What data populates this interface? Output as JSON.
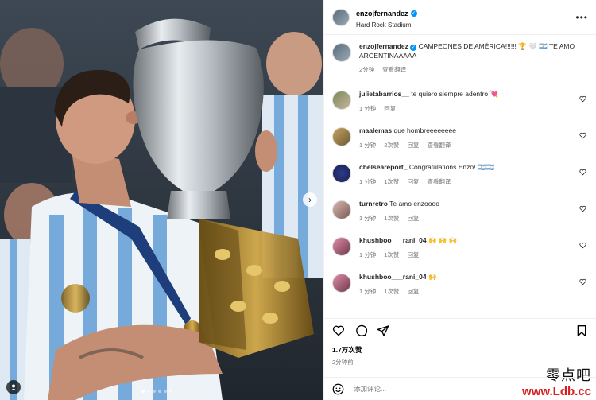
{
  "post": {
    "username": "enzojfernandez",
    "location": "Hard Rock Stadium",
    "more_icon": "more-horizontal-icon"
  },
  "caption": {
    "username": "enzojfernandez",
    "text": "CAMPEONES DE AMÉRICA!!!!!! 🏆 🤍 🇦🇷 TE AMO ARGENTINAAAAA",
    "time": "2分钟",
    "translate": "查看翻译"
  },
  "comments": [
    {
      "username": "julietabarrios__",
      "text": "te quiero siempre adentro 💘",
      "time": "1 分钟",
      "likes": "",
      "reply": "回复",
      "translate": ""
    },
    {
      "username": "maalemas",
      "text": "que hombreeeeeeee",
      "time": "1 分钟",
      "likes": "2次赞",
      "reply": "回复",
      "translate": "查看翻译"
    },
    {
      "username": "chelseareport_",
      "text": "Congratulations Enzo! 🇦🇷🇦🇷",
      "time": "1 分钟",
      "likes": "1次赞",
      "reply": "回复",
      "translate": "查看翻译"
    },
    {
      "username": "turnretro",
      "text": "Te amo enzoooo",
      "time": "1 分钟",
      "likes": "1次赞",
      "reply": "回复",
      "translate": ""
    },
    {
      "username": "khushboo___rani_04",
      "text": "🙌 🙌 🙌",
      "time": "1 分钟",
      "likes": "1次赞",
      "reply": "回复",
      "translate": ""
    },
    {
      "username": "khushboo___rani_04",
      "text": "🙌",
      "time": "1 分钟",
      "likes": "1次赞",
      "reply": "回复",
      "translate": ""
    }
  ],
  "stats": {
    "likes": "1.7万次赞",
    "posted": "2分钟前"
  },
  "comment_box": {
    "placeholder": "添加评论..."
  },
  "watermark": {
    "cn": "零点吧",
    "url": "www.Ldb.cc"
  },
  "colors": {
    "verified": "#0095f6",
    "jersey_blue": "#75aadb",
    "watermark_red": "#d81e1e"
  }
}
